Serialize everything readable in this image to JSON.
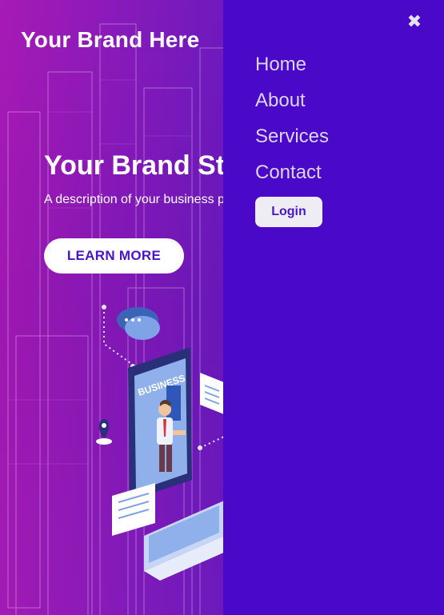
{
  "brand": {
    "name": "Your Brand Here"
  },
  "hero": {
    "title": "Your Brand St",
    "description": "A description of your business provided",
    "cta_label": "LEARN MORE",
    "illustration_label": "BUSINESS"
  },
  "nav": {
    "close_icon": "close-icon",
    "items": [
      {
        "label": "Home"
      },
      {
        "label": "About"
      },
      {
        "label": "Services"
      },
      {
        "label": "Contact"
      }
    ],
    "login_label": "Login"
  },
  "colors": {
    "sidenav_bg": "#4a08c8",
    "accent_text": "#4a14c8",
    "hero_overlay_left": "#be14be",
    "hero_overlay_right": "#460ad2"
  }
}
